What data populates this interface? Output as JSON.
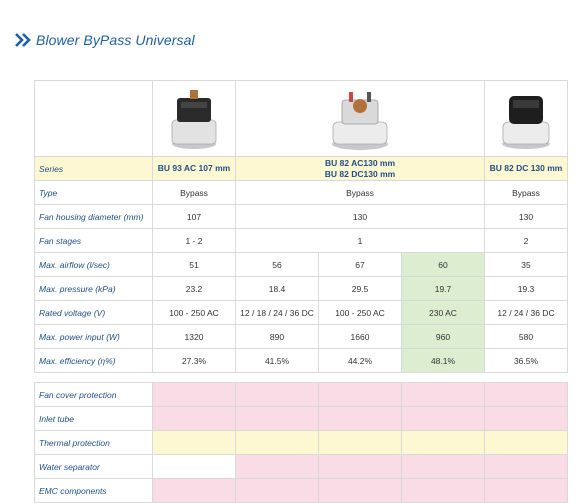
{
  "page": {
    "title": "Blower ByPass Universal"
  },
  "colors": {
    "accent": "#1f5fa6",
    "series_bg": "#fdf7d2",
    "highlight": "#dcedd0",
    "pink": "#fadce6"
  },
  "specs": {
    "series_label": "Series",
    "series": [
      "BU 93 AC 107 mm",
      "BU 82 AC130 mm",
      "BU 82 DC130 mm",
      "BU 82 DC 130 mm"
    ],
    "rows": [
      {
        "label": "Type",
        "c1": "Bypass",
        "c2": "Bypass",
        "c3": "Bypass"
      },
      {
        "label": "Fan housing diameter (mm)",
        "c1": "107",
        "c2": "130",
        "c3": "130"
      },
      {
        "label": "Fan stages",
        "c1": "1 - 2",
        "c2": "1",
        "c3": "2"
      }
    ],
    "airflow": {
      "label": "Max. airflow (l/sec)",
      "values": [
        "51",
        "56",
        "67",
        "60",
        "35"
      ]
    },
    "pressure": {
      "label": "Max. pressure  (kPa)",
      "values": [
        "23.2",
        "18.4",
        "29.5",
        "19.7",
        "19.3"
      ]
    },
    "voltage": {
      "label": "Rated voltage (V)",
      "values": [
        "100 - 250 AC",
        "12 / 18 / 24 / 36 DC",
        "100 - 250 AC",
        "230 AC",
        "12 / 24 / 36 DC"
      ]
    },
    "power": {
      "label": "Max. power input (W)",
      "values": [
        "1320",
        "890",
        "1660",
        "960",
        "580"
      ]
    },
    "efficiency": {
      "label": "Max. efficiency (η%)",
      "values": [
        "27.3%",
        "41.5%",
        "44.2%",
        "48.1%",
        "36.5%"
      ]
    },
    "images": [
      "motor-icon",
      "motor-icon",
      "motor-icon"
    ]
  },
  "features": {
    "rows": [
      {
        "label": "Fan cover protection"
      },
      {
        "label": "Inlet tube"
      },
      {
        "label": "Thermal protection"
      },
      {
        "label": "Water separator"
      },
      {
        "label": "EMC components"
      }
    ]
  }
}
